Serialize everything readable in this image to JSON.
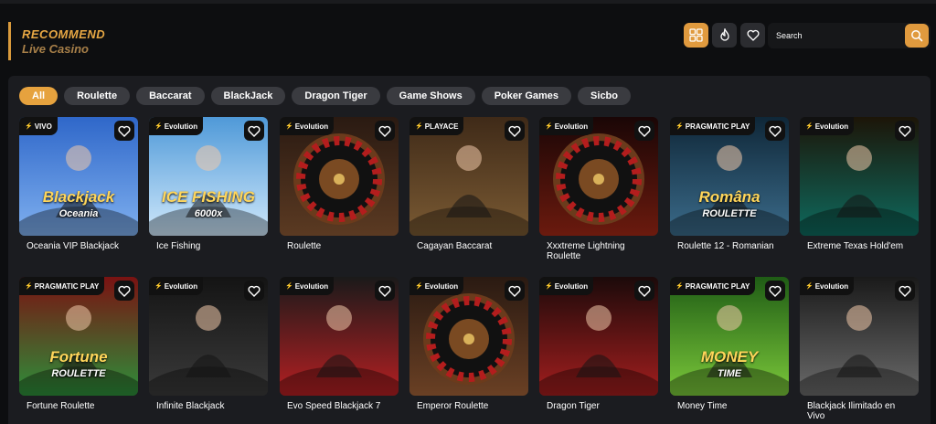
{
  "header": {
    "title": "RECOMMEND",
    "subtitle": "Live Casino"
  },
  "toolbar": {
    "icons": [
      "grid-icon",
      "fire-icon",
      "heart-icon"
    ]
  },
  "search": {
    "placeholder": "Search",
    "icon": "search-icon"
  },
  "categories": [
    "All",
    "Roulette",
    "Baccarat",
    "BlackJack",
    "Dragon Tiger",
    "Game Shows",
    "Poker Games",
    "Sicbo"
  ],
  "games": [
    {
      "name": "Oceania VIP Blackjack",
      "provider": "VIVO",
      "art": "Blackjack",
      "art2": "Oceania",
      "palette": [
        "#2f67c9",
        "#7fb0ef"
      ]
    },
    {
      "name": "Ice Fishing",
      "provider": "Evolution",
      "art": "ICE FISHING",
      "art2": "6000x",
      "palette": [
        "#4f99d8",
        "#cfe8fb"
      ]
    },
    {
      "name": "Roulette",
      "provider": "Evolution",
      "art": "",
      "art2": "",
      "palette": [
        "#2a1a12",
        "#5b3a22"
      ]
    },
    {
      "name": "Cagayan Baccarat",
      "provider": "PLAYACE",
      "art": "",
      "art2": "",
      "palette": [
        "#3f2a18",
        "#7a5a33"
      ]
    },
    {
      "name": "Xxxtreme Lightning Roulette",
      "provider": "Evolution",
      "art": "",
      "art2": "",
      "palette": [
        "#1a0606",
        "#6b1a0e"
      ]
    },
    {
      "name": "Roulette 12 - Romanian",
      "provider": "PRAGMATIC PLAY",
      "art": "Româna",
      "art2": "ROULETTE",
      "palette": [
        "#0f2738",
        "#3b6b8a"
      ]
    },
    {
      "name": "Extreme Texas Hold'em",
      "provider": "Evolution",
      "art": "",
      "art2": "",
      "palette": [
        "#1c1508",
        "#0e6a5e"
      ]
    },
    {
      "name": "Fortune Roulette",
      "provider": "PRAGMATIC PLAY",
      "art": "Fortune",
      "art2": "ROULETTE",
      "palette": [
        "#7a1212",
        "#2d8f3a"
      ]
    },
    {
      "name": "Infinite Blackjack",
      "provider": "Evolution",
      "art": "",
      "art2": "",
      "palette": [
        "#141414",
        "#3a3a3a"
      ]
    },
    {
      "name": "Evo Speed Blackjack 7",
      "provider": "Evolution",
      "art": "",
      "art2": "",
      "palette": [
        "#1a1a1a",
        "#b51f22"
      ]
    },
    {
      "name": "Emperor Roulette",
      "provider": "Evolution",
      "art": "",
      "art2": "",
      "palette": [
        "#2a1a12",
        "#6a4024"
      ]
    },
    {
      "name": "Dragon Tiger",
      "provider": "Evolution",
      "art": "",
      "art2": "",
      "palette": [
        "#1b0a0a",
        "#a31e1e"
      ]
    },
    {
      "name": "Money Time",
      "provider": "PRAGMATIC PLAY",
      "art": "MONEY",
      "art2": "TIME",
      "palette": [
        "#1f5c15",
        "#7bc83a"
      ]
    },
    {
      "name": "Blackjack Ilimitado en Vivo",
      "provider": "Evolution",
      "art": "",
      "art2": "",
      "palette": [
        "#1a1a1a",
        "#6a6a6a"
      ]
    }
  ],
  "colors": {
    "accent": "#e09a3e",
    "chip": "#3a3b40",
    "panel": "#1b1c20",
    "background": "#0d0e10"
  }
}
